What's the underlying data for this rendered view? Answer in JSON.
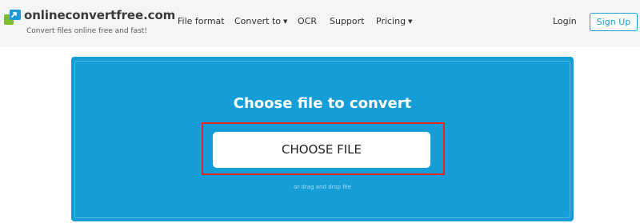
{
  "header": {
    "brand": "onlineconvertfree.com",
    "tagline": "Convert files online free and fast!",
    "nav": [
      {
        "label": "File format",
        "dropdown": false
      },
      {
        "label": "Convert to",
        "dropdown": true
      },
      {
        "label": "OCR",
        "dropdown": false
      },
      {
        "label": "Support",
        "dropdown": false
      },
      {
        "label": "Pricing",
        "dropdown": true
      }
    ],
    "login_label": "Login",
    "signup_label": "Sign Up"
  },
  "upload": {
    "title": "Choose file to convert",
    "button_label": "CHOOSE FILE",
    "drag_text": "or drag and drop file"
  },
  "colors": {
    "panel": "#159dd8",
    "accent": "#1a9bd7",
    "highlight": "#e0242c"
  },
  "icons": {
    "logo": "convert-arrow-logo-icon",
    "caret": "chevron-down-icon"
  }
}
